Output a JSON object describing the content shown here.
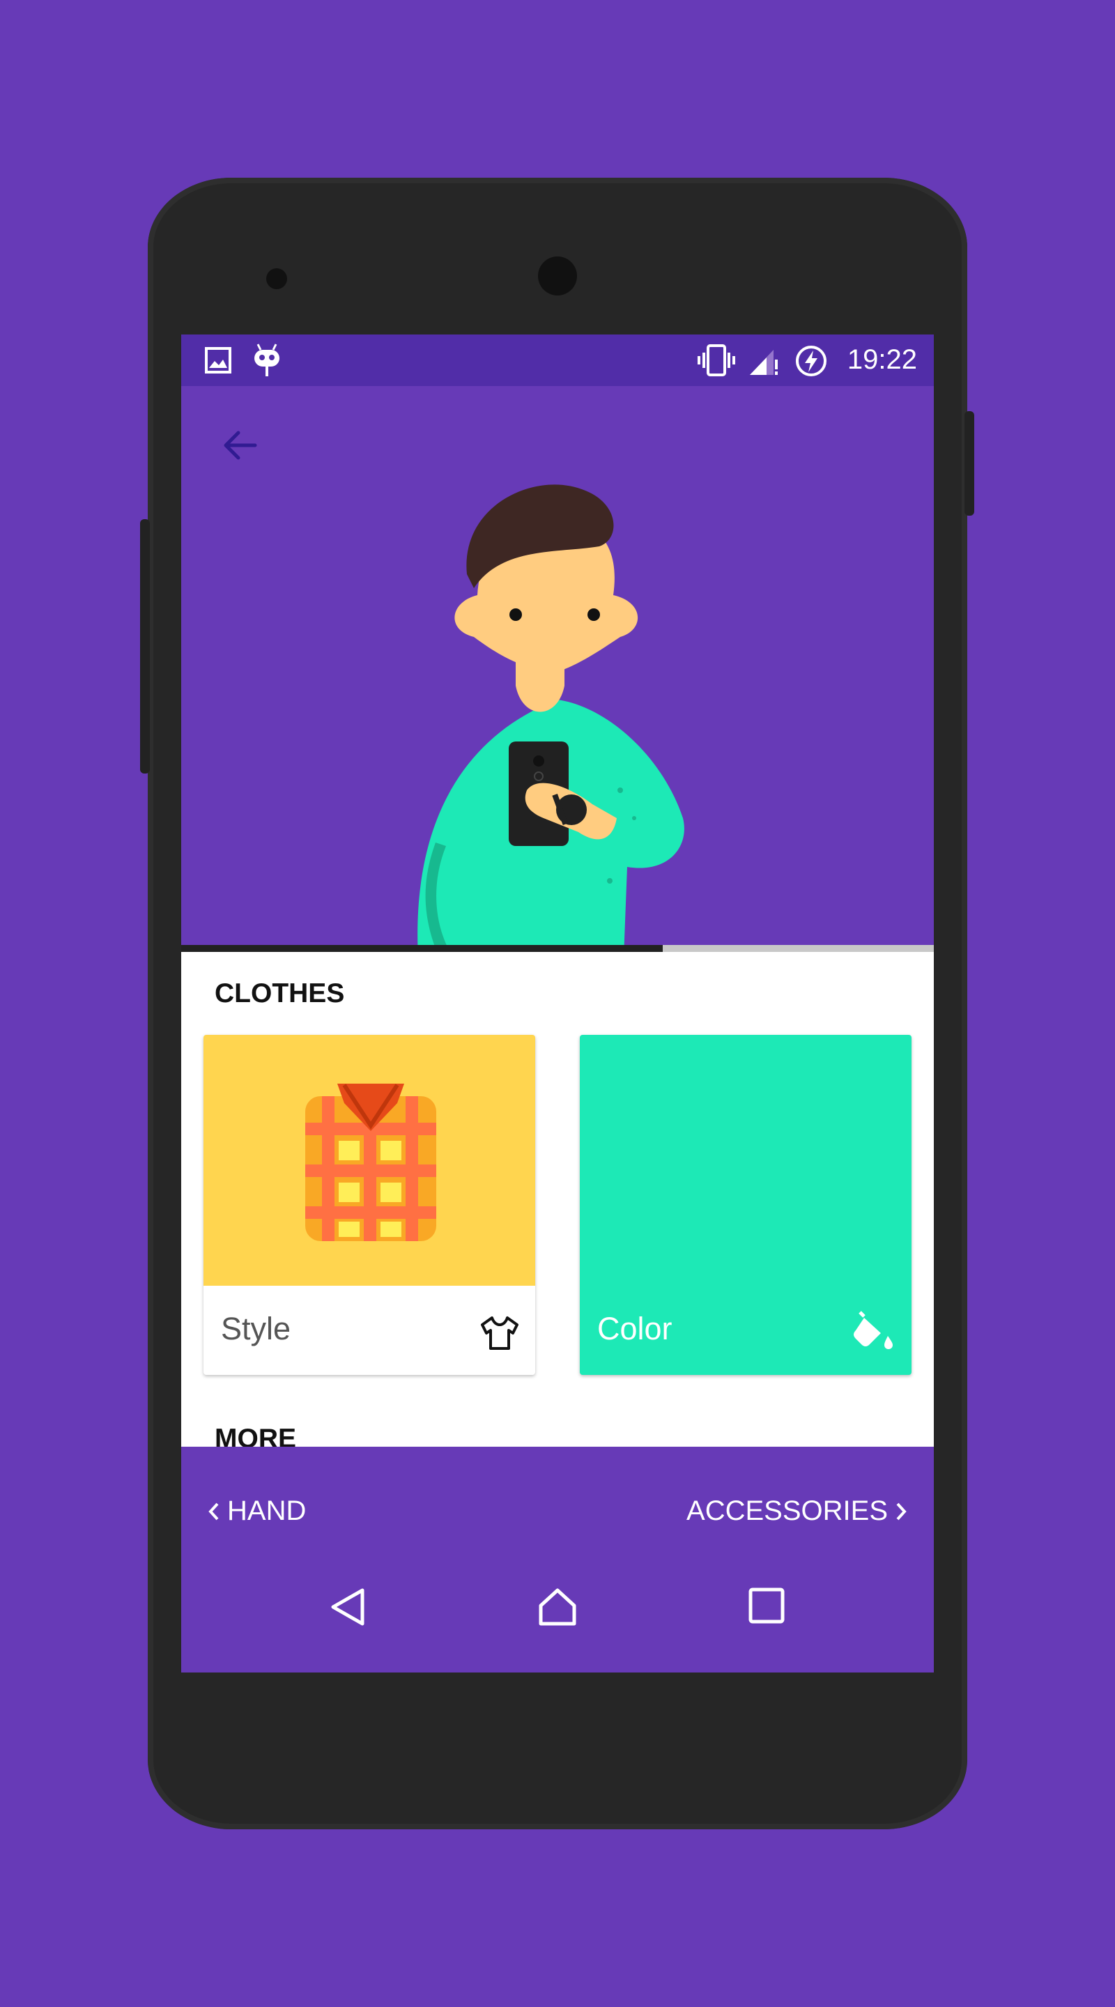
{
  "statusbar": {
    "time": "19:22",
    "icons": [
      "image-icon",
      "android-bot-icon",
      "vibrate-icon",
      "signal-icon",
      "battery-charging-icon"
    ]
  },
  "hero": {
    "back_icon": "arrow-back-icon",
    "illustration": "person-wearing-smartwatch-illustration"
  },
  "progress": {
    "fraction": 0.64
  },
  "sections": {
    "clothes_title": "CLOTHES",
    "more_title": "MORE"
  },
  "cards": [
    {
      "label": "Style",
      "icon": "tshirt-icon",
      "image": "plaid-shirt-illustration",
      "bg": "#FFFFFF",
      "image_bg": "#FFD54F"
    },
    {
      "label": "Color",
      "icon": "paint-bucket-icon",
      "bg": "#1DE9B6"
    }
  ],
  "bottom_nav": {
    "prev_label": "HAND",
    "next_label": "ACCESSORIES"
  },
  "system_nav": [
    "back-triangle-icon",
    "home-icon",
    "recents-square-icon"
  ],
  "colors": {
    "primary": "#673AB7",
    "primary_dark": "#512DA8",
    "accent": "#1DE9B6",
    "shirt_yellow": "#FFD54F"
  }
}
